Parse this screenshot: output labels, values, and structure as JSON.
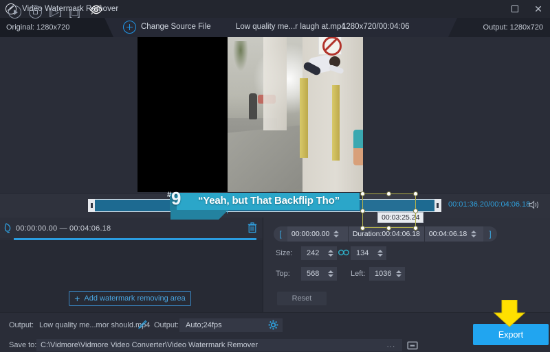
{
  "window": {
    "title": "Video Watermark Remover",
    "logo_icon": "watermark-remover-logo",
    "maximize_icon": "maximize-icon",
    "close_icon": "close-icon"
  },
  "subbar": {
    "original_label": "Original: 1280x720",
    "eye_off_icon": "eye-off-icon",
    "plus_icon": "plus-circle-icon",
    "change_source_label": "Change Source File",
    "file_name": "Low quality me...r laugh at.mp4",
    "file_dimensions": "1280x720/00:04:06",
    "output_label": "Output: 1280x720"
  },
  "preview": {
    "caption_hash": "#",
    "caption_number": "9",
    "caption_text": "“Yeah, but That Backflip Tho”",
    "selection_box_color": "#b5b24a"
  },
  "transport": {
    "play_icon": "play-icon",
    "stop_icon": "stop-icon",
    "step_forward_icon": "step-forward-icon",
    "snapshot_icon": "snapshot-icon",
    "tooltip_time": "00:03:25.24",
    "current_time": "00:01:36.20",
    "total_time": "/00:04:06.18",
    "volume_icon": "volume-icon",
    "accent_color": "#2f9fdb"
  },
  "track": {
    "brush_icon": "watermark-brush-icon",
    "range_label": "00:00:00.00 — 00:04:06.18",
    "delete_icon": "trash-icon"
  },
  "left_panel": {
    "add_area_label": "Add watermark removing area",
    "add_plus_icon": "plus-icon"
  },
  "right_panel": {
    "bracket_open": "[",
    "bracket_close": "]",
    "start_time": "00:00:00.00",
    "duration_label": "Duration:00:04:06.18",
    "end_time": "00:04:06.18",
    "size_label": "Size:",
    "size_width": "242",
    "size_height": "134",
    "link_icon": "link-chain-icon",
    "top_label": "Top:",
    "top_value": "568",
    "left_label": "Left:",
    "left_value": "1036",
    "reset_label": "Reset",
    "spinner_icon": "spinner-arrows-icon"
  },
  "bottom": {
    "output_name_label": "Output:",
    "output_file_name": "Low quality me...mor should.mp4",
    "edit_icon": "pencil-icon",
    "output_format_label": "Output:",
    "output_format_value": "Auto;24fps",
    "settings_icon": "gear-icon",
    "save_to_label": "Save to:",
    "save_to_path": "C:\\Vidmore\\Vidmore Video Converter\\Video Watermark Remover",
    "browse_label": "...",
    "open_folder_icon": "folder-icon",
    "export_label": "Export",
    "export_color": "#21a5f0",
    "annotation_arrow_icon": "down-arrow-annotation-icon",
    "annotation_color": "#ffe000"
  }
}
